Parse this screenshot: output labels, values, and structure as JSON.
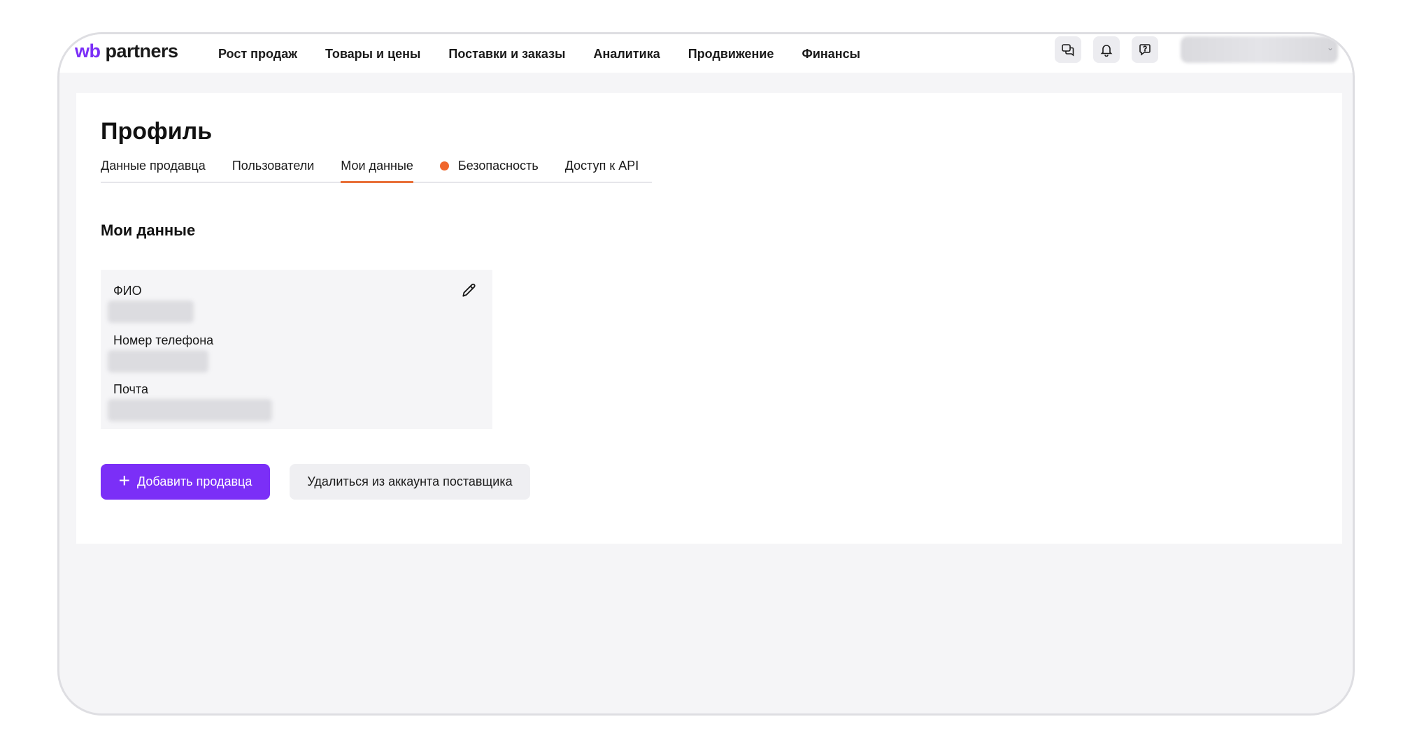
{
  "brand": {
    "prefix": "wb",
    "name": " partners"
  },
  "nav": [
    "Рост продаж",
    "Товары и цены",
    "Поставки и заказы",
    "Аналитика",
    "Продвижение",
    "Финансы"
  ],
  "header_icons": [
    "chat-icon",
    "bell-icon",
    "support-icon"
  ],
  "page_title": "Профиль",
  "tabs": [
    {
      "label": "Данные продавца"
    },
    {
      "label": "Пользователи"
    },
    {
      "label": "Мои данные",
      "active": true
    },
    {
      "label": "Безопасность",
      "alert": true
    },
    {
      "label": "Доступ к API"
    }
  ],
  "section_title": "Мои данные",
  "fields": {
    "name_label": "ФИО",
    "phone_label": "Номер телефона",
    "email_label": "Почта"
  },
  "buttons": {
    "add_seller": "Добавить продавца",
    "leave_account": "Удалиться из аккаунта поставщика"
  },
  "help_label": "?",
  "colors": {
    "accent": "#7b2ff7",
    "tab_indicator": "#e9713a",
    "alert_dot": "#f0662c"
  }
}
